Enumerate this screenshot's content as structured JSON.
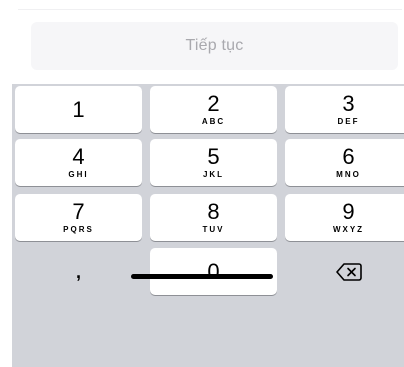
{
  "continue_button": {
    "label": "Tiếp tục"
  },
  "keypad": {
    "keys": [
      {
        "digit": "1",
        "letters": ""
      },
      {
        "digit": "2",
        "letters": "ABC"
      },
      {
        "digit": "3",
        "letters": "DEF"
      },
      {
        "digit": "4",
        "letters": "GHI"
      },
      {
        "digit": "5",
        "letters": "JKL"
      },
      {
        "digit": "6",
        "letters": "MNO"
      },
      {
        "digit": "7",
        "letters": "PQRS"
      },
      {
        "digit": "8",
        "letters": "TUV"
      },
      {
        "digit": "9",
        "letters": "WXYZ"
      }
    ],
    "comma_key": ",",
    "zero_key": "0",
    "backspace_icon": "delete-left-icon"
  },
  "colors": {
    "keyboard_bg": "#d1d3d9",
    "key_bg": "#ffffff",
    "button_bg": "#f6f6f8",
    "button_text": "#a9a9ae"
  }
}
